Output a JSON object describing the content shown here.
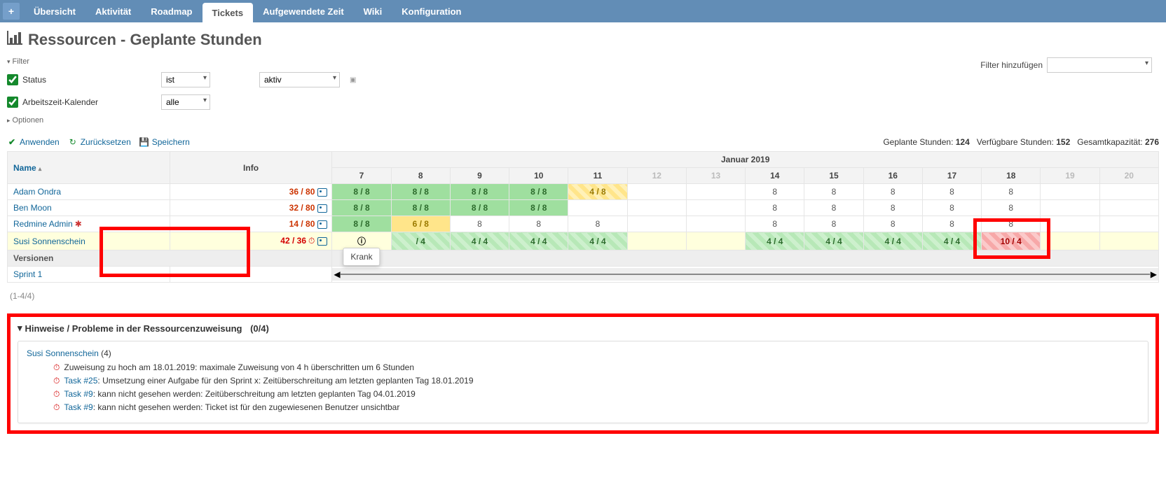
{
  "nav": {
    "plus": "+",
    "tabs": [
      "Übersicht",
      "Aktivität",
      "Roadmap",
      "Tickets",
      "Aufgewendete Zeit",
      "Wiki",
      "Konfiguration"
    ],
    "active": "Tickets"
  },
  "title": "Ressourcen - Geplante Stunden",
  "filters": {
    "section_label": "Filter",
    "options_label": "Optionen",
    "status_label": "Status",
    "status_op": "ist",
    "status_val": "aktiv",
    "worktime_label": "Arbeitszeit-Kalender",
    "worktime_op": "alle",
    "add_label": "Filter hinzufügen"
  },
  "actions": {
    "apply": "Anwenden",
    "reset": "Zurücksetzen",
    "save": "Speichern"
  },
  "totals": {
    "planned_label": "Geplante Stunden:",
    "planned_value": "124",
    "available_label": "Verfügbare Stunden:",
    "available_value": "152",
    "capacity_label": "Gesamtkapazität:",
    "capacity_value": "276"
  },
  "grid": {
    "name_header": "Name",
    "info_header": "Info",
    "month_header": "Januar 2019",
    "days": [
      "7",
      "8",
      "9",
      "10",
      "11",
      "12",
      "13",
      "14",
      "15",
      "16",
      "17",
      "18",
      "19",
      "20"
    ],
    "dim_days": [
      "12",
      "13",
      "19",
      "20"
    ],
    "rows": [
      {
        "name": "Adam Ondra",
        "ratio": "36 / 80",
        "gear": false,
        "clock": false,
        "cells": [
          {
            "t": "8 / 8",
            "c": "green"
          },
          {
            "t": "8 / 8",
            "c": "green"
          },
          {
            "t": "8 / 8",
            "c": "green"
          },
          {
            "t": "8 / 8",
            "c": "green"
          },
          {
            "t": "4 / 8",
            "c": "yellow-stripe"
          },
          {
            "t": "",
            "c": ""
          },
          {
            "t": "",
            "c": ""
          },
          {
            "t": "8",
            "c": "gray"
          },
          {
            "t": "8",
            "c": "gray"
          },
          {
            "t": "8",
            "c": "gray"
          },
          {
            "t": "8",
            "c": "gray"
          },
          {
            "t": "8",
            "c": "gray"
          },
          {
            "t": "",
            "c": ""
          },
          {
            "t": "",
            "c": ""
          }
        ]
      },
      {
        "name": "Ben Moon",
        "ratio": "32 / 80",
        "gear": false,
        "clock": false,
        "cells": [
          {
            "t": "8 / 8",
            "c": "green"
          },
          {
            "t": "8 / 8",
            "c": "green"
          },
          {
            "t": "8 / 8",
            "c": "green"
          },
          {
            "t": "8 / 8",
            "c": "green"
          },
          {
            "t": "",
            "c": "gray"
          },
          {
            "t": "",
            "c": ""
          },
          {
            "t": "",
            "c": ""
          },
          {
            "t": "8",
            "c": "gray"
          },
          {
            "t": "8",
            "c": "gray"
          },
          {
            "t": "8",
            "c": "gray"
          },
          {
            "t": "8",
            "c": "gray"
          },
          {
            "t": "8",
            "c": "gray"
          },
          {
            "t": "",
            "c": ""
          },
          {
            "t": "",
            "c": ""
          }
        ]
      },
      {
        "name": "Redmine Admin",
        "ratio": "14 / 80",
        "gear": true,
        "clock": false,
        "cells": [
          {
            "t": "8 / 8",
            "c": "green"
          },
          {
            "t": "6 / 8",
            "c": "yellow"
          },
          {
            "t": "8",
            "c": "gray"
          },
          {
            "t": "8",
            "c": "gray"
          },
          {
            "t": "8",
            "c": "gray"
          },
          {
            "t": "",
            "c": ""
          },
          {
            "t": "",
            "c": ""
          },
          {
            "t": "8",
            "c": "gray"
          },
          {
            "t": "8",
            "c": "gray"
          },
          {
            "t": "8",
            "c": "gray"
          },
          {
            "t": "8",
            "c": "gray"
          },
          {
            "t": "8",
            "c": "gray"
          },
          {
            "t": "",
            "c": ""
          },
          {
            "t": "",
            "c": ""
          }
        ]
      },
      {
        "name": "Susi Sonnenschein",
        "ratio": "42 / 36",
        "gear": false,
        "clock": true,
        "highlight": true,
        "cells": [
          {
            "t": "ⓘ",
            "c": "tooltip"
          },
          {
            "t": "/ 4",
            "c": "green-stripe"
          },
          {
            "t": "4 / 4",
            "c": "green-stripe"
          },
          {
            "t": "4 / 4",
            "c": "green-stripe"
          },
          {
            "t": "4 / 4",
            "c": "green-stripe"
          },
          {
            "t": "",
            "c": ""
          },
          {
            "t": "",
            "c": ""
          },
          {
            "t": "4 / 4",
            "c": "green-stripe"
          },
          {
            "t": "4 / 4",
            "c": "green-stripe"
          },
          {
            "t": "4 / 4",
            "c": "green-stripe"
          },
          {
            "t": "4 / 4",
            "c": "green-stripe"
          },
          {
            "t": "10 / 4",
            "c": "red-stripe"
          },
          {
            "t": "",
            "c": ""
          },
          {
            "t": "",
            "c": ""
          }
        ]
      }
    ],
    "tooltip_text": "Krank",
    "versions_label": "Versionen",
    "sprint_label": "Sprint 1"
  },
  "pager": "(1-4/4)",
  "problems": {
    "title": "Hinweise / Probleme in der Ressourcenzuweisung",
    "count": "(0/4)",
    "user": "Susi Sonnenschein",
    "user_count": "(4)",
    "lines": [
      {
        "link": "",
        "text": "Zuweisung zu hoch am 18.01.2019: maximale Zuweisung von 4 h überschritten um 6 Stunden"
      },
      {
        "link": "Task #25",
        "text": ": Umsetzung einer Aufgabe für den Sprint x: Zeitüberschreitung am letzten geplanten Tag 18.01.2019"
      },
      {
        "link": "Task #9",
        "text": ": kann nicht gesehen werden: Zeitüberschreitung am letzten geplanten Tag 04.01.2019"
      },
      {
        "link": "Task #9",
        "text": ": kann nicht gesehen werden: Ticket ist für den zugewiesenen Benutzer unsichtbar"
      }
    ]
  }
}
